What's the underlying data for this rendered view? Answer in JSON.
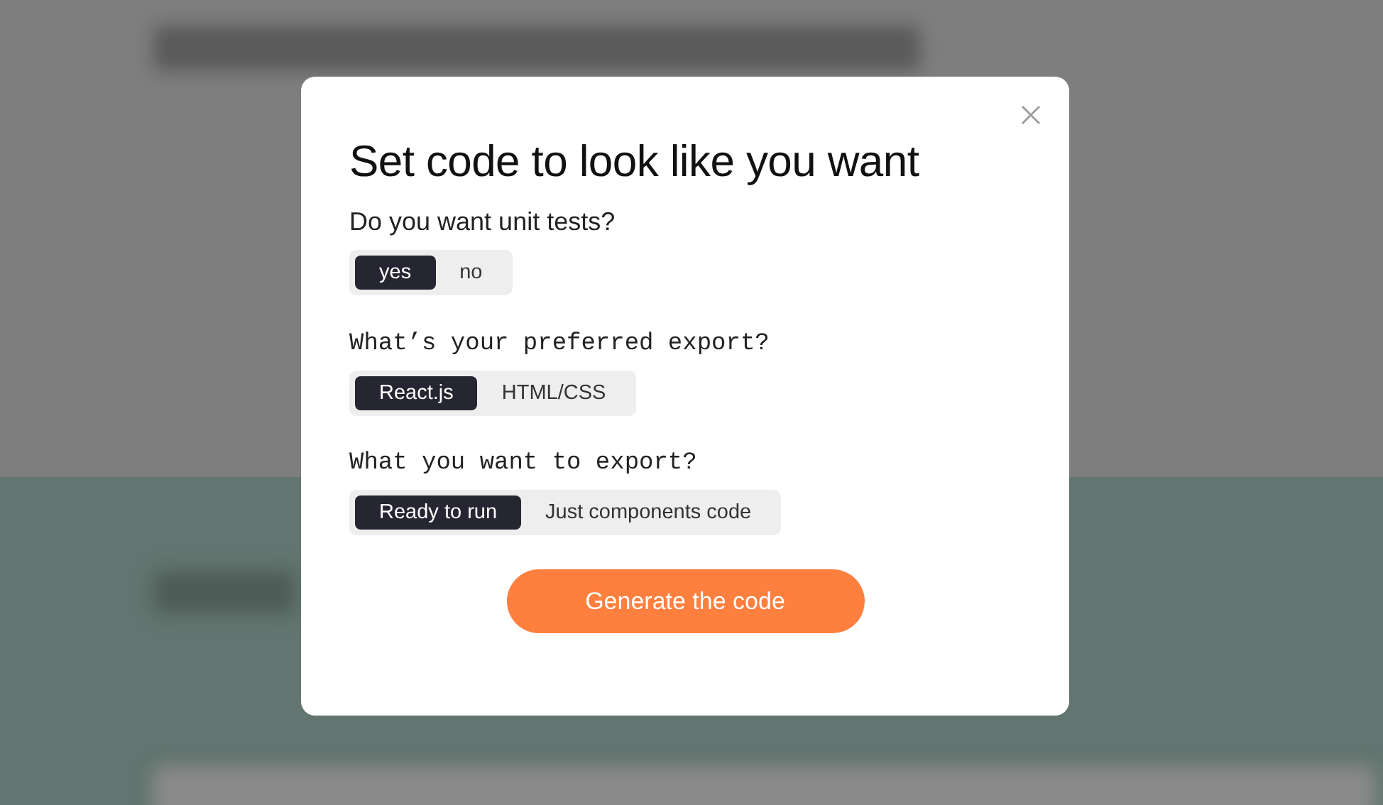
{
  "dialog": {
    "title": "Set code to look like you want",
    "questions": [
      {
        "kind": "plain",
        "label": "Do you want unit tests?",
        "options": [
          {
            "label": "yes",
            "selected": true
          },
          {
            "label": "no",
            "selected": false
          }
        ]
      },
      {
        "kind": "mono",
        "label": "What’s your preferred export?",
        "options": [
          {
            "label": "React.js",
            "selected": true
          },
          {
            "label": "HTML/CSS",
            "selected": false
          }
        ]
      },
      {
        "kind": "mono",
        "label": "What you want to export?",
        "options": [
          {
            "label": "Ready to run",
            "selected": true
          },
          {
            "label": "Just components code",
            "selected": false
          }
        ]
      }
    ],
    "primary_button": "Generate the code"
  }
}
